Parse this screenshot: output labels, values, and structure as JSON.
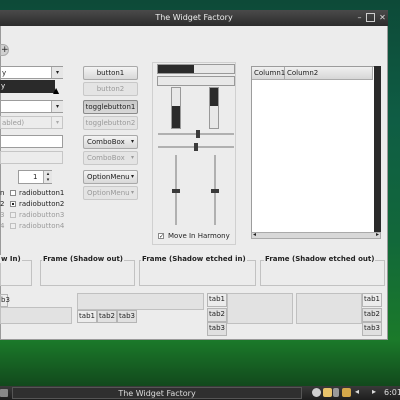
{
  "window": {
    "title": "The Widget Factory"
  },
  "combos": {
    "entry_value": "y",
    "popup_item": "y",
    "disabled_value": "abled)"
  },
  "buttons": {
    "button1": "button1",
    "button2": "button2",
    "togglebutton1": "togglebutton1",
    "togglebutton2": "togglebutton2",
    "combobox": "ComboBox",
    "combobox_disabled": "ComboBox",
    "optionmenu": "OptionMenu",
    "optionmenu_disabled": "OptionMenu"
  },
  "spin": {
    "value": "1"
  },
  "radio_labels": [
    "radiobutton1",
    "radiobutton2",
    "radiobutton3",
    "radiobutton4"
  ],
  "move_in_harmony": "Move In Harmony",
  "tree": {
    "columns": [
      "Column1",
      "Column2"
    ]
  },
  "frames": {
    "shadow_in": "w In)",
    "shadow_out": "Frame (Shadow out)",
    "shadow_etched_in": "Frame (Shadow etched in)",
    "shadow_etched_out": "Frame (Shadow etched out)"
  },
  "tabs": {
    "left_clip": "b3",
    "bottom": [
      "tab1",
      "tab2",
      "tab3"
    ],
    "left": [
      "tab1",
      "tab2",
      "tab3"
    ],
    "right": [
      "tab1",
      "tab2",
      "tab3"
    ]
  },
  "taskbar": {
    "title": "The Widget Factory",
    "clock": "6:01"
  },
  "colors": {
    "window_bg": "#ececec",
    "titlebar": "#2c2c2c",
    "desktop": "#12683a"
  },
  "progress": {
    "horizontal_fraction": 0.48,
    "vertical_left_fraction": 0.55,
    "vertical_right_fraction": 0.45
  }
}
